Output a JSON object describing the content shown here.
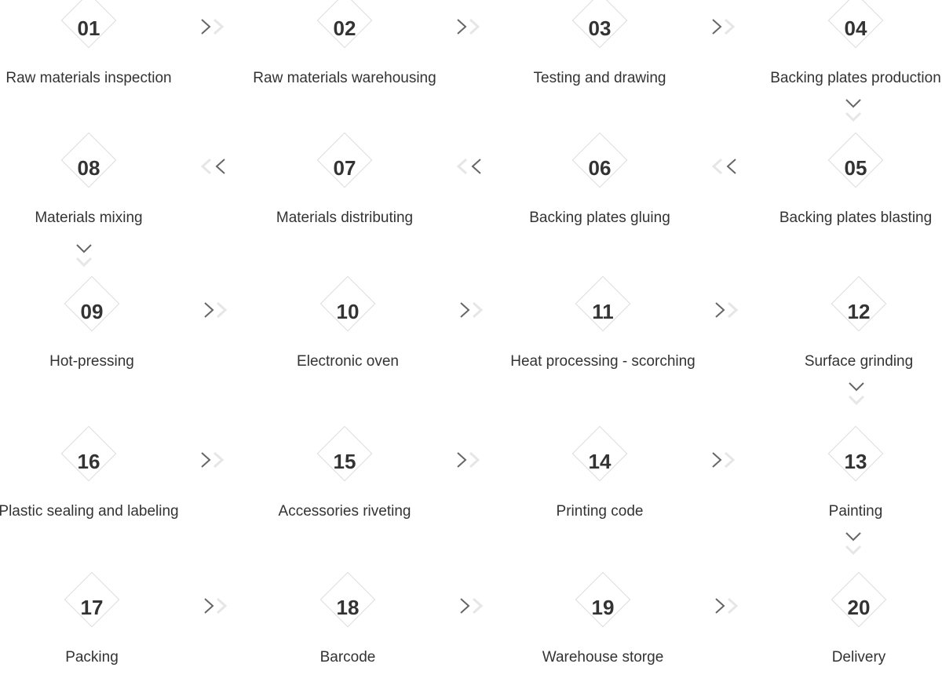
{
  "steps": [
    {
      "num": "01",
      "label": "Raw materials inspection"
    },
    {
      "num": "02",
      "label": "Raw materials warehousing"
    },
    {
      "num": "03",
      "label": "Testing and drawing"
    },
    {
      "num": "04",
      "label": "Backing plates production"
    },
    {
      "num": "05",
      "label": "Backing plates blasting"
    },
    {
      "num": "06",
      "label": "Backing plates gluing"
    },
    {
      "num": "07",
      "label": "Materials distributing"
    },
    {
      "num": "08",
      "label": "Materials mixing"
    },
    {
      "num": "09",
      "label": "Hot-pressing"
    },
    {
      "num": "10",
      "label": "Electronic oven"
    },
    {
      "num": "11",
      "label": "Heat processing - scorching"
    },
    {
      "num": "12",
      "label": "Surface grinding"
    },
    {
      "num": "13",
      "label": "Painting"
    },
    {
      "num": "14",
      "label": "Printing code"
    },
    {
      "num": "15",
      "label": "Accessories riveting"
    },
    {
      "num": "16",
      "label": "Plastic sealing and labeling"
    },
    {
      "num": "17",
      "label": "Packing"
    },
    {
      "num": "18",
      "label": "Barcode"
    },
    {
      "num": "19",
      "label": "Warehouse storge"
    },
    {
      "num": "20",
      "label": "Delivery"
    }
  ],
  "colors": {
    "arrow_dark": "#666666",
    "arrow_light": "#e6e6e6",
    "diamond_border": "#dcdcdc",
    "text": "#333333"
  }
}
